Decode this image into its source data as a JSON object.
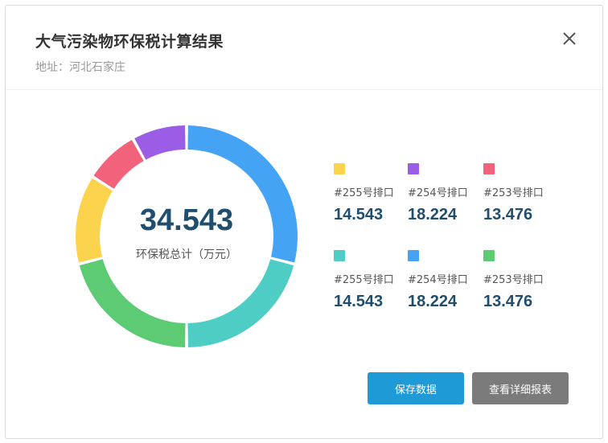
{
  "dialog": {
    "title": "大气污染物环保税计算结果",
    "subtitle": "地址：河北石家庄"
  },
  "summary": {
    "total_value": "34.543",
    "total_label": "环保税总计（万元）"
  },
  "legend": [
    {
      "name": "#255号排口",
      "value": "14.543",
      "color": "#fcd34d"
    },
    {
      "name": "#254号排口",
      "value": "18.224",
      "color": "#9b5de5"
    },
    {
      "name": "#253号排口",
      "value": "13.476",
      "color": "#f2637b"
    },
    {
      "name": "#255号排口",
      "value": "14.543",
      "color": "#4ecdc4"
    },
    {
      "name": "#254号排口",
      "value": "18.224",
      "color": "#44a3f5"
    },
    {
      "name": "#253号排口",
      "value": "13.476",
      "color": "#5ccb74"
    }
  ],
  "chart_data": {
    "type": "pie",
    "segments": [
      {
        "color": "#44a3f5",
        "share": 0.29
      },
      {
        "color": "#4ecdc4",
        "share": 0.21
      },
      {
        "color": "#5ccb74",
        "share": 0.21
      },
      {
        "color": "#fcd34d",
        "share": 0.13
      },
      {
        "color": "#f2637b",
        "share": 0.08
      },
      {
        "color": "#9b5de5",
        "share": 0.08
      }
    ]
  },
  "actions": {
    "save_label": "保存数据",
    "detail_label": "查看详细报表"
  },
  "icons": {
    "close": "close-icon"
  }
}
